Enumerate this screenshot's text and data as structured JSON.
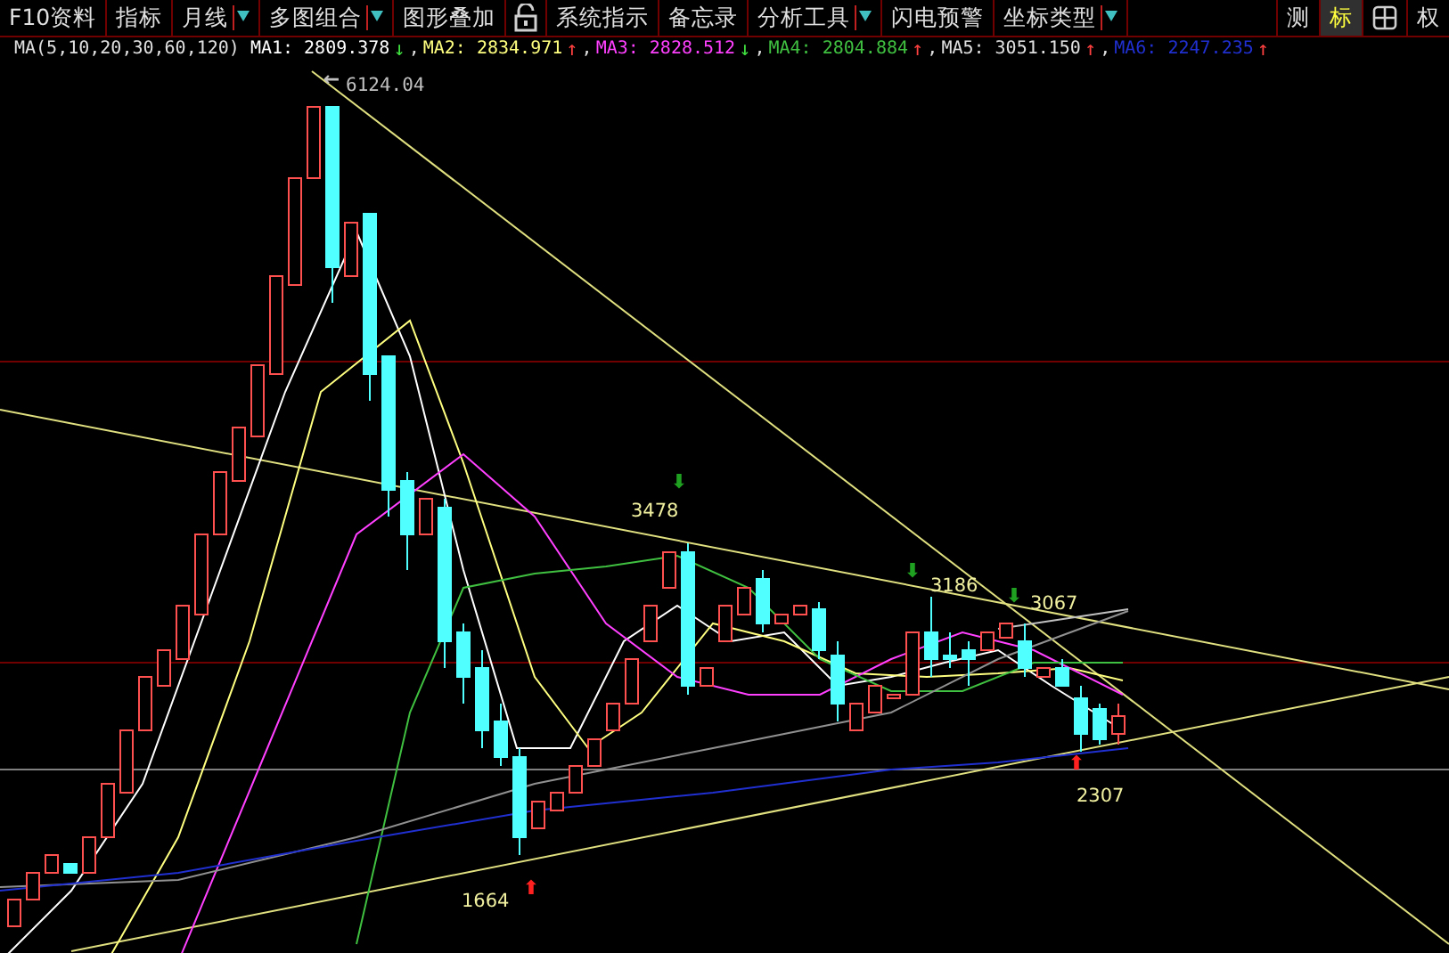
{
  "toolbar": {
    "left": [
      {
        "kind": "button",
        "label": "F10资料"
      },
      {
        "kind": "button",
        "label": "指标"
      },
      {
        "kind": "dropdown",
        "label": "月线"
      },
      {
        "kind": "dropdown",
        "label": "多图组合"
      },
      {
        "kind": "button",
        "label": "图形叠加"
      },
      {
        "kind": "lock"
      },
      {
        "kind": "button",
        "label": "系统指示"
      },
      {
        "kind": "button",
        "label": "备忘录"
      },
      {
        "kind": "dropdown",
        "label": "分析工具"
      },
      {
        "kind": "button",
        "label": "闪电预警"
      },
      {
        "kind": "dropdown",
        "label": "坐标类型"
      }
    ],
    "right": [
      {
        "kind": "button",
        "label": "测",
        "selected": false
      },
      {
        "kind": "button",
        "label": "标",
        "selected": true
      },
      {
        "kind": "grid",
        "selected": false
      },
      {
        "kind": "button",
        "label": "权",
        "selected": false
      }
    ]
  },
  "ma_row": {
    "title": "MA(5,10,20,30,60,120)",
    "items": [
      {
        "text": "MA1: 2809.378",
        "color": "#ffffff",
        "kind": "falling",
        "arrow": "↓",
        "separator": ","
      },
      {
        "text": "MA2: 2834.971",
        "color": "#ffff80",
        "kind": "rising",
        "arrow": "↑",
        "separator": ","
      },
      {
        "text": "MA3: 2828.512",
        "color": "#ff40ff",
        "kind": "falling",
        "arrow": "↓",
        "separator": ","
      },
      {
        "text": "MA4: 2804.884",
        "color": "#40c040",
        "kind": "rising",
        "arrow": "↑",
        "separator": ","
      },
      {
        "text": "MA5: 3051.150",
        "color": "#e0e0e0",
        "kind": "rising",
        "arrow": "↑",
        "separator": ","
      },
      {
        "text": "MA6: 2247.235",
        "color": "#2030d0",
        "kind": "rising",
        "arrow": "↑"
      }
    ]
  },
  "annotations": [
    {
      "text": "6124.04",
      "kind": "peak",
      "marker": "←"
    },
    {
      "text": "3478",
      "kind": "high",
      "marker": "⬇"
    },
    {
      "text": "3186",
      "kind": "high",
      "marker": "⬇"
    },
    {
      "text": "3067",
      "kind": "high",
      "marker": "⬇"
    },
    {
      "text": "2307",
      "kind": "low",
      "marker": "⬆"
    },
    {
      "text": "1664",
      "kind": "low",
      "marker": "⬆"
    }
  ]
}
